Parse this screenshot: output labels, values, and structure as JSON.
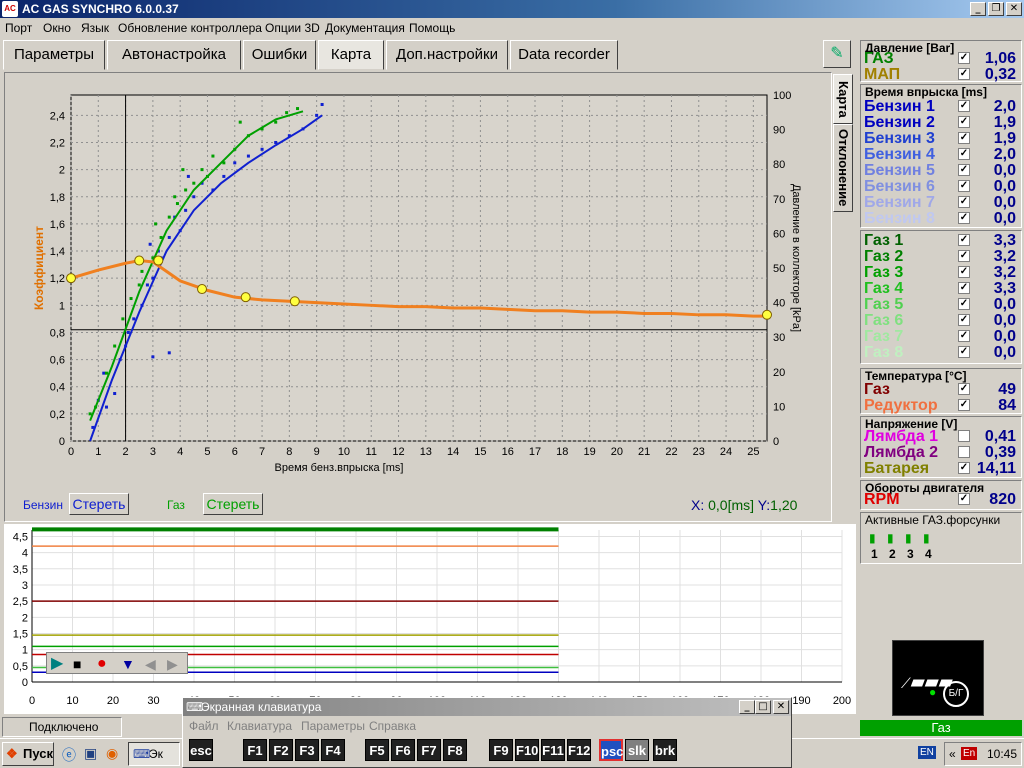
{
  "window": {
    "title": "AC GAS SYNCHRO  6.0.0.37",
    "logo": "AC",
    "controls": [
      "_",
      "❐",
      "✕"
    ]
  },
  "menu": [
    "Порт",
    "Окно",
    "Язык",
    "Обновление контроллера",
    "Опции 3D",
    "Документация",
    "Помощь"
  ],
  "tabs": [
    "Параметры",
    "Автонастройка",
    "Ошибки",
    "Карта",
    "Доп.настройки",
    "Data recorder"
  ],
  "vtabs": [
    "Карта",
    "Отклонение"
  ],
  "chart_data": {
    "type": "scatter",
    "xlabel": "Время бенз.впрыска [ms]",
    "ylabel": "Коэффициент",
    "y2label": "Давление в коллекторе [kPa]",
    "xlim": [
      0,
      25.5
    ],
    "ylim": [
      0,
      2.55
    ],
    "y2lim": [
      0,
      100
    ],
    "x_ticks": [
      0,
      1,
      2,
      3,
      4,
      5,
      6,
      7,
      8,
      9,
      10,
      11,
      12,
      13,
      14,
      15,
      16,
      17,
      18,
      19,
      20,
      21,
      22,
      23,
      24,
      25
    ],
    "y_ticks": [
      "0",
      "0,2",
      "0,4",
      "0,6",
      "0,8",
      "1",
      "1,2",
      "1,4",
      "1,6",
      "1,8",
      "2",
      "2,2",
      "2,4"
    ],
    "y_tick_values": [
      0,
      0.2,
      0.4,
      0.6,
      0.8,
      1.0,
      1.2,
      1.4,
      1.6,
      1.8,
      2.0,
      2.2,
      2.4
    ],
    "y2_ticks": [
      0,
      10,
      20,
      30,
      40,
      50,
      60,
      70,
      80,
      90,
      100
    ],
    "grid": true,
    "crosshair": {
      "x": 2.0,
      "y": 0.82
    },
    "series": [
      {
        "name": "Бензин",
        "color": "#1020d0",
        "points": [
          [
            0.8,
            0.1
          ],
          [
            1.0,
            0.3
          ],
          [
            1.2,
            0.5
          ],
          [
            1.3,
            0.25
          ],
          [
            1.6,
            0.35
          ],
          [
            1.8,
            0.6
          ],
          [
            2.0,
            0.7
          ],
          [
            2.1,
            0.8
          ],
          [
            2.3,
            0.9
          ],
          [
            2.6,
            1.0
          ],
          [
            2.8,
            1.15
          ],
          [
            3.0,
            1.2
          ],
          [
            3.2,
            1.4
          ],
          [
            3.3,
            1.35
          ],
          [
            3.6,
            1.5
          ],
          [
            3.8,
            1.65
          ],
          [
            4.0,
            1.55
          ],
          [
            4.2,
            1.7
          ],
          [
            4.5,
            1.8
          ],
          [
            4.8,
            1.9
          ],
          [
            5.2,
            1.85
          ],
          [
            5.6,
            1.95
          ],
          [
            6.0,
            2.05
          ],
          [
            6.5,
            2.1
          ],
          [
            7.0,
            2.15
          ],
          [
            7.5,
            2.2
          ],
          [
            8.0,
            2.25
          ],
          [
            8.5,
            2.3
          ],
          [
            9.0,
            2.4
          ],
          [
            9.2,
            2.48
          ],
          [
            3.0,
            0.62
          ],
          [
            3.6,
            0.65
          ],
          [
            2.9,
            1.45
          ],
          [
            4.3,
            1.95
          ]
        ],
        "trend": [
          [
            0.7,
            0.0
          ],
          [
            1.5,
            0.45
          ],
          [
            2.5,
            0.95
          ],
          [
            3.5,
            1.4
          ],
          [
            4.5,
            1.7
          ],
          [
            5.5,
            1.9
          ],
          [
            6.5,
            2.05
          ],
          [
            7.5,
            2.18
          ],
          [
            8.5,
            2.3
          ],
          [
            9.2,
            2.4
          ]
        ]
      },
      {
        "name": "Газ",
        "color": "#00a000",
        "points": [
          [
            0.7,
            0.2
          ],
          [
            0.9,
            0.25
          ],
          [
            1.3,
            0.5
          ],
          [
            1.6,
            0.7
          ],
          [
            1.9,
            0.9
          ],
          [
            2.2,
            1.05
          ],
          [
            2.6,
            1.25
          ],
          [
            3.0,
            1.35
          ],
          [
            3.3,
            1.5
          ],
          [
            3.6,
            1.65
          ],
          [
            3.9,
            1.75
          ],
          [
            4.2,
            1.85
          ],
          [
            4.5,
            1.9
          ],
          [
            4.8,
            2.0
          ],
          [
            5.2,
            2.1
          ],
          [
            5.6,
            2.05
          ],
          [
            6.0,
            2.15
          ],
          [
            6.5,
            2.25
          ],
          [
            7.0,
            2.3
          ],
          [
            7.5,
            2.35
          ],
          [
            7.9,
            2.42
          ],
          [
            8.3,
            2.45
          ],
          [
            2.5,
            1.15
          ],
          [
            3.1,
            1.6
          ],
          [
            3.8,
            1.8
          ],
          [
            4.1,
            2.0
          ],
          [
            5.0,
            1.95
          ],
          [
            6.2,
            2.35
          ]
        ],
        "trend": [
          [
            0.7,
            0.15
          ],
          [
            1.5,
            0.55
          ],
          [
            2.5,
            1.1
          ],
          [
            3.5,
            1.55
          ],
          [
            4.5,
            1.85
          ],
          [
            5.5,
            2.05
          ],
          [
            6.5,
            2.25
          ],
          [
            7.5,
            2.37
          ],
          [
            8.5,
            2.43
          ]
        ]
      },
      {
        "name": "Давление",
        "color": "#f08020",
        "points": [
          [
            0,
            1.2
          ],
          [
            1,
            1.26
          ],
          [
            2,
            1.31
          ],
          [
            2.5,
            1.33
          ],
          [
            3,
            1.32
          ],
          [
            3.5,
            1.25
          ],
          [
            4,
            1.18
          ],
          [
            5,
            1.11
          ],
          [
            6,
            1.06
          ],
          [
            7,
            1.04
          ],
          [
            8,
            1.03
          ],
          [
            9,
            1.02
          ],
          [
            10,
            1.01
          ],
          [
            11,
            1.0
          ],
          [
            12,
            0.99
          ],
          [
            13,
            0.99
          ],
          [
            14,
            0.98
          ],
          [
            15,
            0.98
          ],
          [
            16,
            0.97
          ],
          [
            17,
            0.96
          ],
          [
            18,
            0.96
          ],
          [
            19,
            0.95
          ],
          [
            20,
            0.95
          ],
          [
            21,
            0.94
          ],
          [
            22,
            0.94
          ],
          [
            23,
            0.93
          ],
          [
            24,
            0.93
          ],
          [
            25,
            0.92
          ],
          [
            25.5,
            0.92
          ]
        ],
        "nodes": [
          [
            0,
            1.2
          ],
          [
            2.5,
            1.33
          ],
          [
            3.2,
            1.33
          ],
          [
            4.8,
            1.12
          ],
          [
            6.4,
            1.06
          ],
          [
            8.2,
            1.03
          ],
          [
            25.5,
            0.93
          ]
        ]
      }
    ]
  },
  "legend": {
    "benzin": "Бензин",
    "gaz": "Газ",
    "clear": "Стереть",
    "benzin_color": "#1020d0",
    "gaz_color": "#00a000"
  },
  "cursor": {
    "x_label": "X:",
    "x_val": "0,0",
    "x_unit": "[ms]",
    "y_label": "Y:",
    "y_val": "1,20"
  },
  "lower_chart": {
    "type": "line",
    "x_ticks": [
      0,
      10,
      20,
      30,
      40,
      50,
      60,
      70,
      80,
      90,
      100,
      110,
      120,
      130,
      140,
      150,
      160,
      170,
      180,
      190,
      200
    ],
    "y_ticks": [
      "0",
      "0,5",
      "1",
      "1,5",
      "2",
      "2,5",
      "3",
      "3,5",
      "4",
      "4,5"
    ],
    "y_tick_values": [
      0,
      0.5,
      1.0,
      1.5,
      2.0,
      2.5,
      3.0,
      3.5,
      4.0,
      4.5
    ],
    "xlim": [
      0,
      200
    ],
    "ylim": [
      0,
      4.7
    ],
    "series": [
      {
        "name": "",
        "color": "#008000",
        "level": 4.72,
        "end": 130
      },
      {
        "name": "",
        "color": "#f08040",
        "level": 4.2,
        "end": 130
      },
      {
        "name": "",
        "color": "#800000",
        "level": 2.5,
        "end": 130
      },
      {
        "name": "",
        "color": "#a0a000",
        "level": 1.45,
        "end": 130
      },
      {
        "name": "",
        "color": "#00a000",
        "level": 1.1,
        "end": 130
      },
      {
        "name": "",
        "color": "#c00000",
        "level": 0.85,
        "end": 130
      },
      {
        "name": "",
        "color": "#0000c0",
        "level": 0.3,
        "end": 130
      },
      {
        "name": "",
        "color": "#40c040",
        "level": 0.45,
        "end": 130
      }
    ]
  },
  "player_controls": [
    "play-icon",
    "stop-icon",
    "record-icon",
    "download-icon",
    "prev-icon",
    "next-icon"
  ],
  "status": {
    "connected": "Подключено"
  },
  "right": {
    "pressure": {
      "title": "Давление [Bar]",
      "rows": [
        {
          "name": "ГАЗ",
          "color": "#008000",
          "value": "1,06",
          "checked": true
        },
        {
          "name": "МАП",
          "color": "#a08000",
          "value": "0,32",
          "checked": true
        }
      ]
    },
    "injection": {
      "title": "Время впрыска [ms]",
      "rows": [
        {
          "name": "Бензин 1",
          "color": "#0000c0",
          "value": "2,0",
          "checked": true
        },
        {
          "name": "Бензин 2",
          "color": "#0000c0",
          "value": "1,9",
          "checked": true
        },
        {
          "name": "Бензин 3",
          "color": "#2040d0",
          "value": "1,9",
          "checked": true
        },
        {
          "name": "Бензин 4",
          "color": "#4060e0",
          "value": "2,0",
          "checked": true
        },
        {
          "name": "Бензин 5",
          "color": "#7080e0",
          "value": "0,0",
          "checked": true
        },
        {
          "name": "Бензин 6",
          "color": "#8090e0",
          "value": "0,0",
          "checked": true
        },
        {
          "name": "Бензин 7",
          "color": "#a0a8e8",
          "value": "0,0",
          "checked": true
        },
        {
          "name": "Бензин 8",
          "color": "#c0c8f0",
          "value": "0,0",
          "checked": true
        }
      ]
    },
    "gas": {
      "rows": [
        {
          "name": "Газ 1",
          "color": "#006000",
          "value": "3,3",
          "checked": true
        },
        {
          "name": "Газ 2",
          "color": "#008000",
          "value": "3,2",
          "checked": true
        },
        {
          "name": "Газ 3",
          "color": "#00a000",
          "value": "3,2",
          "checked": true
        },
        {
          "name": "Газ 4",
          "color": "#20c020",
          "value": "3,3",
          "checked": true
        },
        {
          "name": "Газ 5",
          "color": "#50d050",
          "value": "0,0",
          "checked": true
        },
        {
          "name": "Газ 6",
          "color": "#80e080",
          "value": "0,0",
          "checked": true
        },
        {
          "name": "Газ 7",
          "color": "#a0e8a0",
          "value": "0,0",
          "checked": true
        },
        {
          "name": "Газ 8",
          "color": "#c0f0c0",
          "value": "0,0",
          "checked": true
        }
      ]
    },
    "temp": {
      "title": "Температура  [°C]",
      "rows": [
        {
          "name": "Газ",
          "color": "#800000",
          "value": "49",
          "checked": true
        },
        {
          "name": "Редуктор",
          "color": "#f07040",
          "value": "84",
          "checked": true
        }
      ]
    },
    "voltage": {
      "title": "Напряжение [V]",
      "rows": [
        {
          "name": "Лямбда 1",
          "color": "#e000e0",
          "value": "0,41",
          "checked": false
        },
        {
          "name": "Лямбда 2",
          "color": "#800080",
          "value": "0,39",
          "checked": false
        },
        {
          "name": "Батарея",
          "color": "#808000",
          "value": "14,11",
          "checked": true
        }
      ]
    },
    "rpm": {
      "title": "Обороты двигателя",
      "rows": [
        {
          "name": "RPM",
          "color": "#e00000",
          "value": "820",
          "checked": true
        }
      ]
    },
    "injectors": {
      "title": "Активные ГАЗ.форсунки",
      "labels": [
        "1",
        "2",
        "3",
        "4"
      ]
    },
    "switch_label": "Б/Г",
    "gas_status": "Газ"
  },
  "osk": {
    "title": "Экранная клавиатура",
    "menu": [
      "Файл",
      "Клавиатура",
      "Параметры",
      "Справка"
    ],
    "keys": [
      "esc",
      "F1",
      "F2",
      "F3",
      "F4",
      "F5",
      "F6",
      "F7",
      "F8",
      "F9",
      "F10",
      "F11",
      "F12",
      "psc",
      "slk",
      "brk"
    ]
  },
  "taskbar": {
    "start": "Пуск",
    "task": "Эк",
    "lang": "EN",
    "lang2": "En",
    "time": "10:45"
  }
}
